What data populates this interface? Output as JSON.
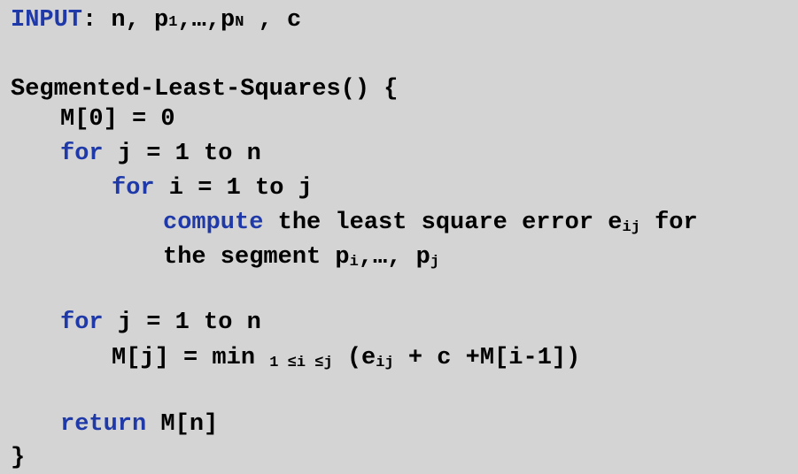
{
  "colors": {
    "background": "#d4d4d4",
    "text": "#000000",
    "keyword": "#1f3aa8"
  },
  "input_line": {
    "keyword": "INPUT",
    "colon": ": n, ",
    "p1_base": "p",
    "p1_sub": "1",
    "mid": ",…,",
    "pn_base": "p",
    "pn_sub": "N",
    "tail": " , c"
  },
  "function_header": "Segmented-Least-Squares() {",
  "m0_line": "M[0] = 0",
  "loop1": {
    "keyword": "for",
    "rest": " j = 1 to n"
  },
  "loop1_inner": {
    "keyword": "for",
    "rest": " i = 1 to j"
  },
  "compute_line": {
    "keyword": "compute",
    "text": " the least square error e",
    "sub": "ij",
    "tail": " for"
  },
  "segment_line": {
    "text": "the segment p",
    "sub_i": "i",
    "mid": ",…, p",
    "sub_j": "j"
  },
  "loop2": {
    "keyword": "for",
    "rest": " j = 1 to n"
  },
  "mj_line": {
    "head": "M[j] = min ",
    "range": "1 ≤i ≤j",
    "open": " (e",
    "sub": "ij",
    "tail": " + c +M[i-1])"
  },
  "return_line": {
    "keyword": "return",
    "rest": " M[n]"
  },
  "closing_brace": "}"
}
